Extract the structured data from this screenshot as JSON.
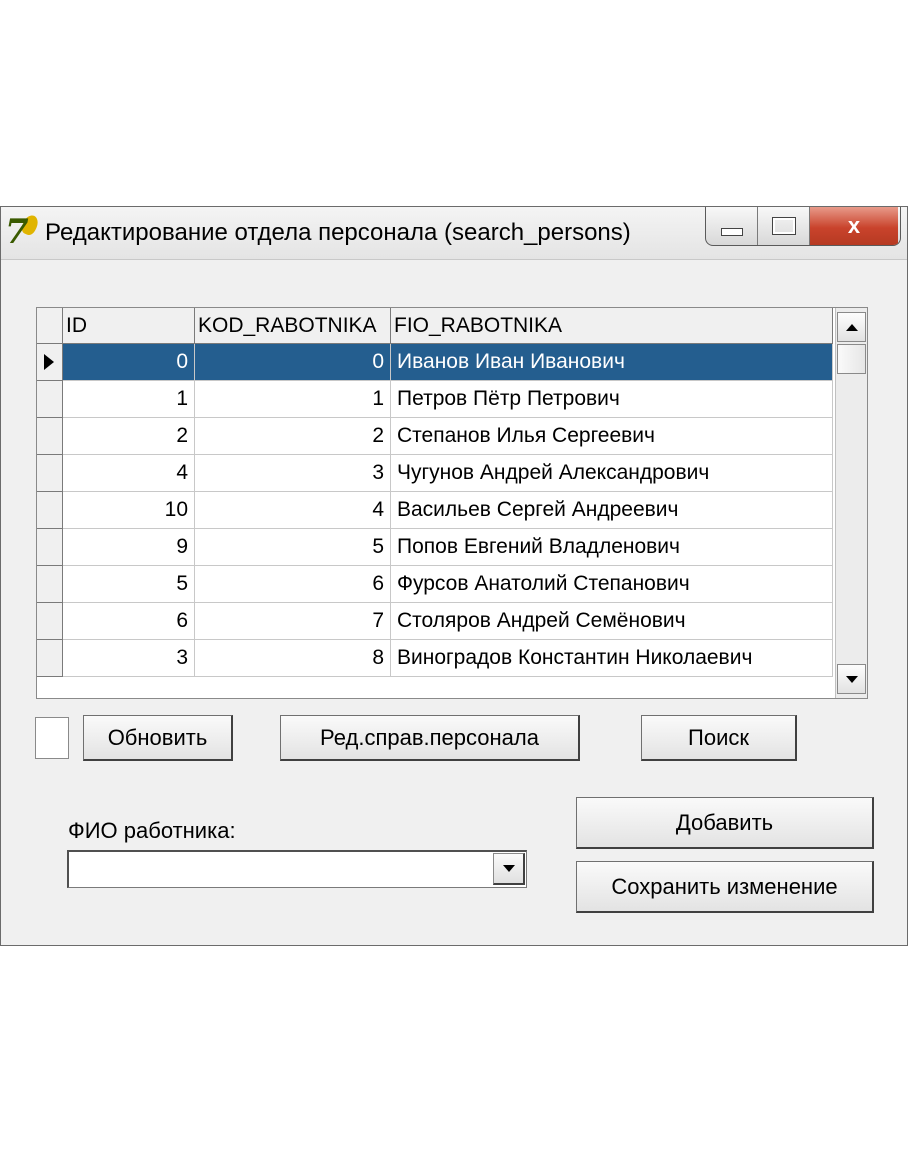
{
  "window": {
    "title": "Редактирование отдела персонала (search_persons)",
    "close_label": "x"
  },
  "grid": {
    "columns": [
      "ID",
      "KOD_RABOTNIKA",
      "FIO_RABOTNIKA"
    ],
    "selected_row": 0,
    "rows": [
      {
        "id": "0",
        "kod": "0",
        "fio": "Иванов Иван Иванович"
      },
      {
        "id": "1",
        "kod": "1",
        "fio": "Петров Пётр Петрович"
      },
      {
        "id": "2",
        "kod": "2",
        "fio": "Степанов Илья Сергеевич"
      },
      {
        "id": "4",
        "kod": "3",
        "fio": "Чугунов Андрей Александрович"
      },
      {
        "id": "10",
        "kod": "4",
        "fio": "Васильев Сергей Андреевич"
      },
      {
        "id": "9",
        "kod": "5",
        "fio": "Попов Евгений Владленович"
      },
      {
        "id": "5",
        "kod": "6",
        "fio": "Фурсов Анатолий Степанович"
      },
      {
        "id": "6",
        "kod": "7",
        "fio": "Столяров Андрей Семёнович"
      },
      {
        "id": "3",
        "kod": "8",
        "fio": "Виноградов Константин Николаевич"
      }
    ]
  },
  "buttons": {
    "refresh": "Обновить",
    "edit_directory": "Ред.справ.персонала",
    "search": "Поиск",
    "add": "Добавить",
    "save": "Сохранить изменение"
  },
  "form": {
    "fio_label": "ФИО работника:",
    "fio_value": ""
  },
  "colors": {
    "selection": "#245e8f",
    "window_bg": "#f0f0f0",
    "close_button": "#c9432c"
  }
}
